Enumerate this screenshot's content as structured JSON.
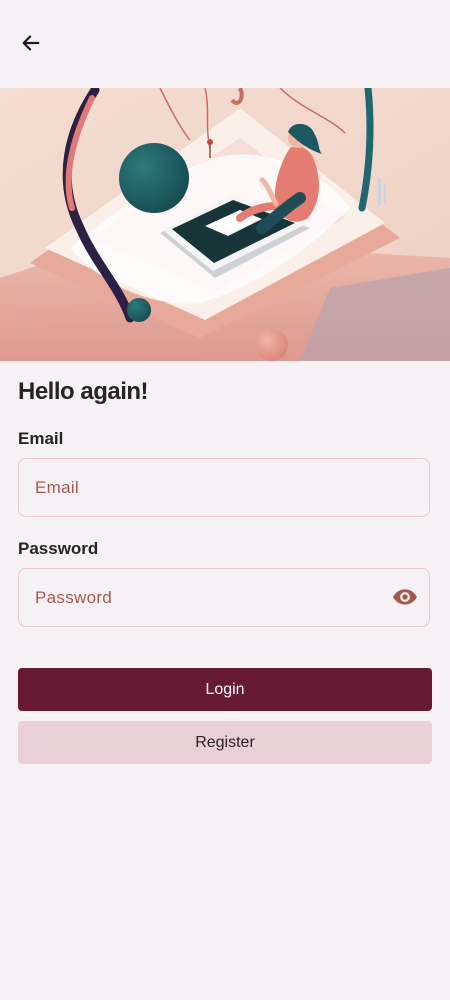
{
  "colors": {
    "background": "#f6f1f5",
    "primary": "#661a33",
    "secondary": "#e9d0d6",
    "placeholder": "#a65a4d",
    "border": "#e9c6cd",
    "text": "#2b2225"
  },
  "header": {
    "back_icon": "arrow-left-icon"
  },
  "hero": {
    "image": "illustration-person-with-phone"
  },
  "form": {
    "title": "Hello again!",
    "email": {
      "label": "Email",
      "placeholder": "Email",
      "value": ""
    },
    "password": {
      "label": "Password",
      "placeholder": "Password",
      "value": "",
      "toggle_icon": "eye-icon"
    }
  },
  "actions": {
    "login_label": "Login",
    "register_label": "Register"
  }
}
